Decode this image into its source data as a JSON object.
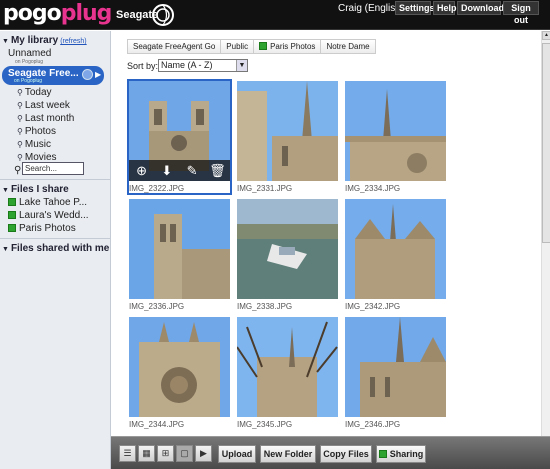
{
  "header": {
    "logo_pogo": "pogo",
    "logo_plug": "plug",
    "brand": "Seagate",
    "user": "Craig (English)",
    "buttons": [
      "Settings",
      "Help",
      "Downloads",
      "Sign out"
    ]
  },
  "sidebar": {
    "my_library": "My library",
    "refresh": "(refresh)",
    "devices": [
      {
        "name": "Unnamed",
        "sub": "on Pogoplug"
      },
      {
        "name": "Seagate Free...",
        "sub": "on Pogoplug"
      }
    ],
    "nav": [
      "Today",
      "Last week",
      "Last month",
      "Photos",
      "Music",
      "Movies"
    ],
    "search_value": "Search...",
    "files_i_share": "Files I share",
    "shared_items": [
      "Lake Tahoe P...",
      "Laura's Wedd...",
      "Paris Photos"
    ],
    "files_shared_with_me": "Files shared with me"
  },
  "breadcrumb": [
    "Seagate FreeAgent Go",
    "Public",
    "Paris Photos",
    "Notre Dame"
  ],
  "sort": {
    "label": "Sort by:",
    "value": "Name (A - Z)"
  },
  "photos": [
    "IMG_2322.JPG",
    "IMG_2331.JPG",
    "IMG_2334.JPG",
    "IMG_2336.JPG",
    "IMG_2338.JPG",
    "IMG_2342.JPG",
    "IMG_2344.JPG",
    "IMG_2345.JPG",
    "IMG_2346.JPG"
  ],
  "toolbar": {
    "upload": "Upload",
    "new_folder": "New Folder",
    "copy_files": "Copy Files",
    "sharing": "Sharing"
  },
  "colors": {
    "accent": "#2a64c5",
    "brand_pink": "#e8338f",
    "header_bg": "#111111"
  }
}
